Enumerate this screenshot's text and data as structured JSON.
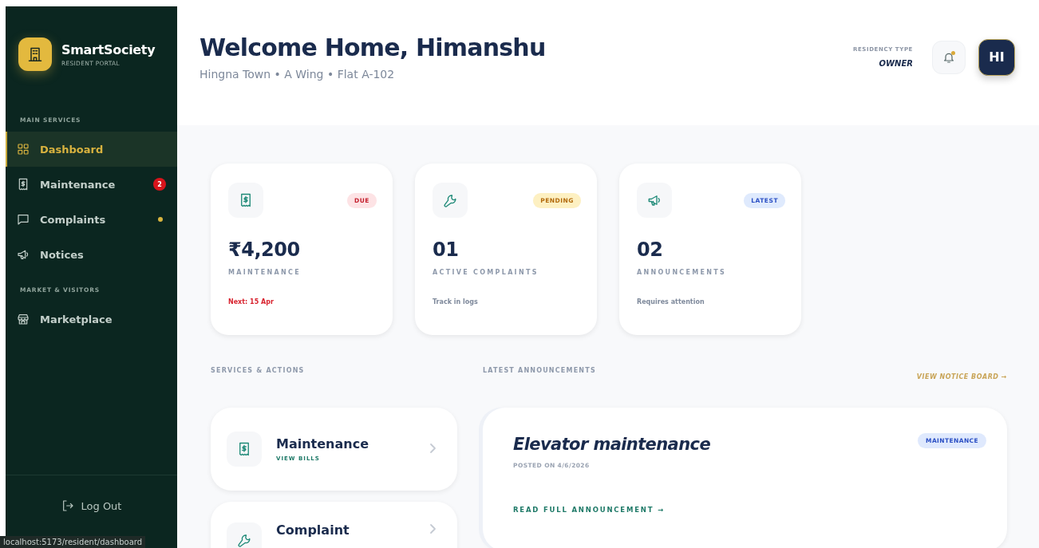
{
  "sidebar": {
    "brand": {
      "name": "SmartSociety",
      "tagline": "RESIDENT PORTAL"
    },
    "sections": [
      {
        "heading": "MAIN SERVICES",
        "items": [
          {
            "label": "Dashboard",
            "selected": true
          },
          {
            "label": "Maintenance",
            "selected": false,
            "badge": "2"
          },
          {
            "label": "Complaints",
            "selected": false,
            "dot": true
          },
          {
            "label": "Notices",
            "selected": false
          }
        ]
      },
      {
        "heading": "MARKET & VISITORS",
        "items": [
          {
            "label": "Marketplace",
            "selected": false
          }
        ]
      }
    ],
    "logout": "Log Out"
  },
  "header": {
    "title": "Welcome Home, Himanshu",
    "subtitle": "Hingna Town • A Wing • Flat A-102",
    "residency_label": "RESIDENCY TYPE",
    "residency_value": "OWNER",
    "notification_dot": true,
    "avatar": "HI"
  },
  "stats": [
    {
      "tag": "DUE",
      "kind": "danger",
      "value": "₹4,200",
      "label": "MAINTENANCE",
      "note": "Next: 15 Apr",
      "note_alert": true
    },
    {
      "tag": "PENDING",
      "kind": "warning",
      "value": "01",
      "label": "ACTIVE COMPLAINTS",
      "note": "Track in logs",
      "note_alert": false
    },
    {
      "tag": "LATEST",
      "kind": "info",
      "value": "02",
      "label": "ANNOUNCEMENTS",
      "note": "Requires attention",
      "note_alert": false
    }
  ],
  "services": {
    "heading": "SERVICES & ACTIONS",
    "items": [
      {
        "title": "Maintenance",
        "action": "VIEW BILLS"
      },
      {
        "title": "Complaint"
      }
    ]
  },
  "announcements": {
    "heading": "LATEST ANNOUNCEMENTS",
    "link": "VIEW NOTICE BOARD →",
    "items": [
      {
        "title": "Elevator maintenance",
        "posted": "POSTED ON 4/6/2026",
        "tag": "MAINTENANCE",
        "link": "READ FULL ANNOUNCEMENT →"
      }
    ]
  },
  "status_bar": "localhost:5173/resident/dashboard"
}
